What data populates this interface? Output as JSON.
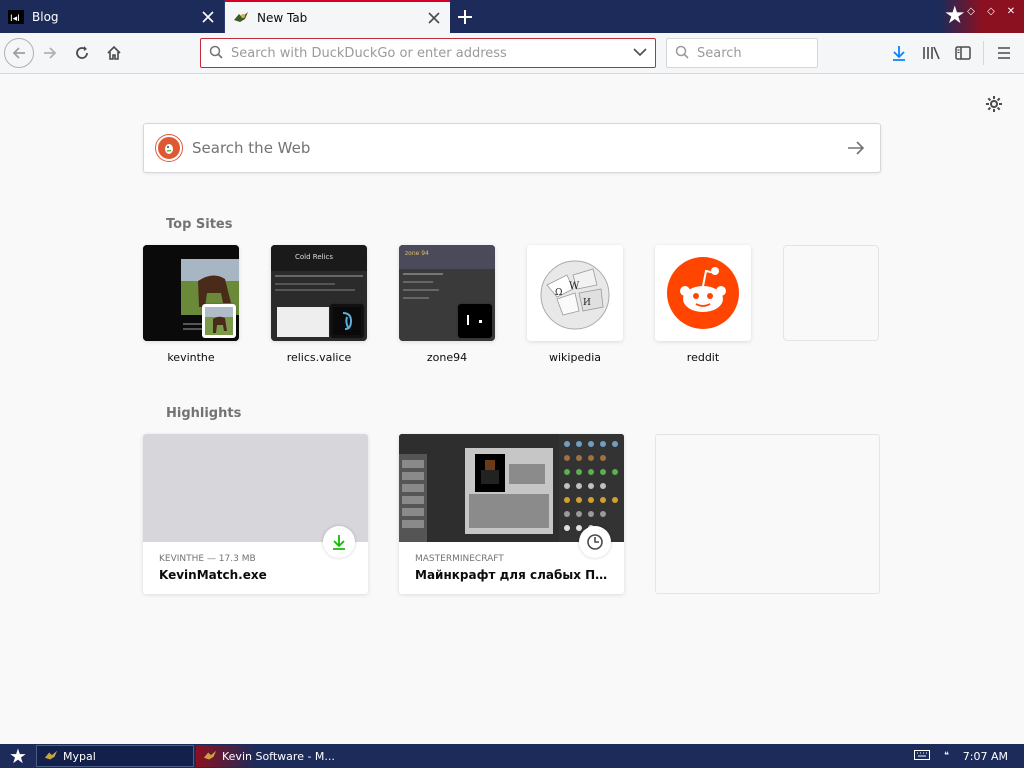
{
  "colors": {
    "accent": "#d70022",
    "tabstrip": "#1c2b5a",
    "download_green": "#12bc00",
    "reddit": "#ff4500",
    "ddg": "#de5833"
  },
  "tabs": [
    {
      "title": "Blog",
      "favicon": "blog-favicon",
      "active": false
    },
    {
      "title": "New Tab",
      "favicon": "mypal-favicon",
      "active": true
    }
  ],
  "toolbar": {
    "urlbar_placeholder": "Search with DuckDuckGo or enter address",
    "search_placeholder": "Search"
  },
  "newtab": {
    "websearch_placeholder": "Search the Web",
    "topsites_title": "Top Sites",
    "highlights_title": "Highlights",
    "topsites": [
      {
        "label": "kevinthe",
        "thumb": "kevinthe-thumb"
      },
      {
        "label": "relics.valice",
        "thumb": "relics-thumb",
        "thumb_text": "Cold Relics"
      },
      {
        "label": "zone94",
        "thumb": "zone94-thumb",
        "thumb_text": "zone 94"
      },
      {
        "label": "wikipedia",
        "thumb": "wikipedia-icon"
      },
      {
        "label": "reddit",
        "thumb": "reddit-icon"
      },
      {
        "label": "",
        "thumb": "empty"
      }
    ],
    "highlights": [
      {
        "meta": "KEVINTHE — 17.3 MB",
        "title": "KevinMatch.exe",
        "badge": "download-icon"
      },
      {
        "meta": "MASTERMINECRAFT",
        "title": "Майнкрафт для слабых ПК - Mi...",
        "badge": "clock-icon"
      }
    ]
  },
  "taskbar": {
    "tasks": [
      {
        "label": "Mypal"
      },
      {
        "label": "Kevin Software - M..."
      }
    ],
    "clock": "7:07 AM"
  }
}
